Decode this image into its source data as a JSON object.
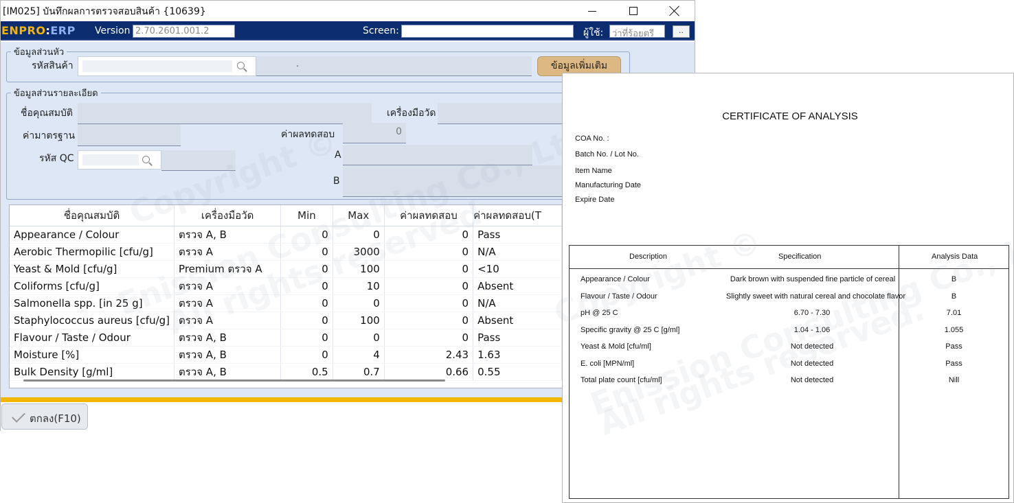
{
  "window": {
    "title": "[IM025] บันทึกผลการตรวจสอบสินค้า {10639}"
  },
  "appbar": {
    "logo_a": "ENPRO",
    "logo_b": ":",
    "logo_c": "ERP",
    "version_label": "Version",
    "version_value": "2.70.2601.001.2",
    "screen_label": "Screen:",
    "screen_value": "",
    "user_label": "ผู้ใช้:",
    "user_value": "ว่าที่ร้อยตรี",
    "more_label": ".."
  },
  "header_group": {
    "legend": "ข้อมูลส่วนหัว",
    "product_code_label": "รหัสสินค้า",
    "product_name_value": ".",
    "more_button": "ข้อมูลเพิ่มเติม"
  },
  "detail_group": {
    "legend": "ข้อมูลส่วนรายละเอียด",
    "property_name_label": "ชื่อคุณสมบัติ",
    "instrument_label": "เครื่องมือวัด",
    "standard_label": "ค่ามาตรฐาน",
    "test_result_label": "ค่าผลทดสอบ",
    "test_result_value": "0",
    "qc_code_label": "รหัส QC",
    "a_label": "A",
    "b_label": "B"
  },
  "grid": {
    "columns": [
      "ชื่อคุณสมบัติ",
      "เครื่องมือวัด",
      "Min",
      "Max",
      "ค่าผลทดสอบ",
      "ค่าผลทดสอบ(T"
    ],
    "rows": [
      [
        "Appearance / Colour",
        "ตรวจ A, B",
        "0",
        "0",
        "0",
        "Pass"
      ],
      [
        "Aerobic Thermopilic [cfu/g]",
        "ตรวจ A",
        "0",
        "3000",
        "0",
        "N/A"
      ],
      [
        "Yeast & Mold [cfu/g]",
        "Premium ตรวจ A",
        "0",
        "100",
        "0",
        "<10"
      ],
      [
        "Coliforms [cfu/g]",
        "ตรวจ A",
        "0",
        "10",
        "0",
        "Absent"
      ],
      [
        "Salmonella spp. [in 25 g]",
        "ตรวจ A",
        "0",
        "0",
        "0",
        "N/A"
      ],
      [
        "Staphylococcus aureus [cfu/g]",
        "ตรวจ A",
        "0",
        "100",
        "0",
        "Absent"
      ],
      [
        "Flavour / Taste / Odour",
        "ตรวจ A, B",
        "0",
        "0",
        "0",
        "Pass"
      ],
      [
        "Moisture [%]",
        "ตรวจ A, B",
        "0",
        "4",
        "2.43",
        "1.63"
      ],
      [
        "Bulk Density [g/ml]",
        "ตรวจ A, B",
        "0.5",
        "0.7",
        "0.66",
        "0.55"
      ]
    ]
  },
  "footer": {
    "ok_button": "ตกลง(F10)"
  },
  "certificate": {
    "title": "CERTIFICATE OF ANALYSIS",
    "meta": [
      "COA No. :",
      "Batch No. / Lot No.",
      "Item Name",
      "Manufacturing Date",
      "Expire Date"
    ],
    "headers": {
      "description": "Description",
      "specification": "Specification",
      "analysis": "Analysis Data"
    },
    "rows": [
      {
        "description": "Appearance / Colour",
        "specification": "Dark brown with suspended fine particle of cereal",
        "analysis": "B"
      },
      {
        "description": "Flavour / Taste / Odour",
        "specification": "Slightly sweet with natural cereal and chocolate flavor",
        "analysis": "B"
      },
      {
        "description": "pH @ 25 C",
        "specification": "6.70 - 7.30",
        "analysis": "7.01"
      },
      {
        "description": "Specific gravity @ 25 C [g/ml]",
        "specification": "1.04 - 1.06",
        "analysis": "1.055"
      },
      {
        "description": "Yeast & Mold [cfu/ml]",
        "specification": "Not detected",
        "analysis": "Pass"
      },
      {
        "description": "E. coli [MPN/ml]",
        "specification": "Not detected",
        "analysis": "Pass"
      },
      {
        "description": "Total plate count [cfu/ml]",
        "specification": "Not detected",
        "analysis": "Nill"
      }
    ]
  },
  "watermark": {
    "line1": "Copyright ©",
    "line2": "Enission Consulting Co., Ltd.",
    "line3": "All rights reserved."
  }
}
